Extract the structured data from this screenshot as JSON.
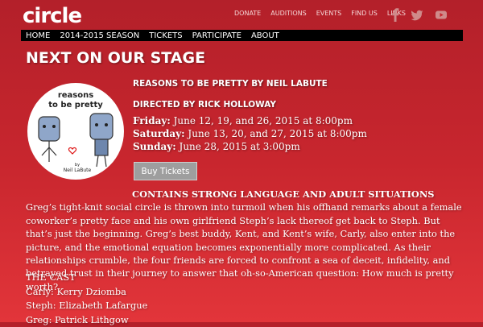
{
  "logo": "circle",
  "top_nav": [
    "DONATE",
    "AUDITIONS",
    "EVENTS",
    "FIND US",
    "LINKS"
  ],
  "social_icons": [
    "facebook-icon",
    "twitter-icon",
    "youtube-icon"
  ],
  "main_nav": [
    "HOME",
    "2014-2015 SEASON",
    "TICKETS",
    "PARTICIPATE",
    "ABOUT"
  ],
  "page_title": "NEXT ON OUR STAGE",
  "poster": {
    "title_line1": "reasons",
    "title_line2": "to be pretty",
    "byline_by": "by",
    "byline_author": "Neil LaBute"
  },
  "show": {
    "title": "REASONS TO BE PRETTY BY NEIL LABUTE",
    "director": "DIRECTED BY RICK HOLLOWAY",
    "schedule": [
      {
        "day": "Friday:",
        "text": " June 12, 19, and 26, 2015 at 8:00pm"
      },
      {
        "day": "Saturday:",
        "text": " June 13, 20, and 27, 2015 at 8:00pm"
      },
      {
        "day": "Sunday:",
        "text": " June 28, 2015 at 3:00pm"
      }
    ],
    "buy_label": "Buy Tickets"
  },
  "synopsis": {
    "warning": "CONTAINS STRONG LANGUAGE AND ADULT SITUATIONS",
    "text": " Greg’s tight-knit social circle is thrown into turmoil when his offhand remarks about a female coworker’s pretty face and his own girlfriend Steph’s lack thereof get back to Steph. But that’s just the beginning. Greg’s best buddy, Kent, and Kent’s wife, Carly, also enter into the picture, and the emotional equation becomes exponentially more complicated. As their relationships crumble, the four friends are forced to confront a sea of deceit, infidelity, and betrayed trust in their journey to answer that oh-so-American question: How much is pretty worth?"
  },
  "cast": {
    "heading": "THE CAST",
    "members": [
      "Carly: Kerry Dziomba",
      "Steph: Elizabeth Lafargue",
      "Greg: Patrick Lithgow"
    ]
  }
}
